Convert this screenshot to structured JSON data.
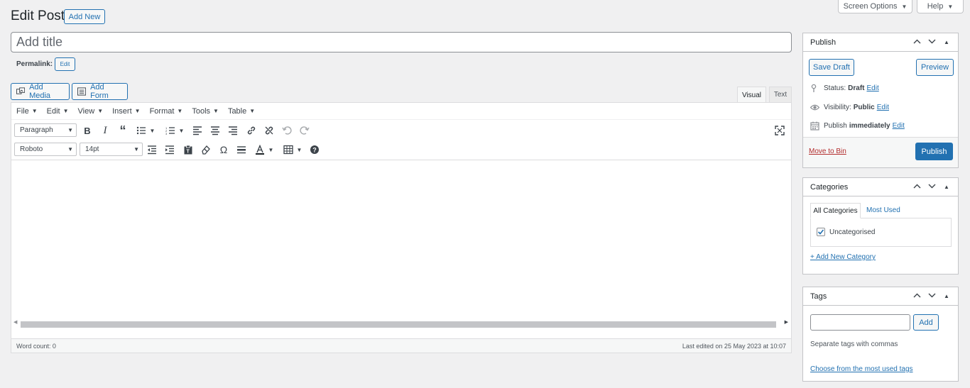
{
  "top": {
    "screen_options": "Screen Options",
    "help": "Help"
  },
  "header": {
    "title": "Edit Post",
    "add_new": "Add New"
  },
  "title_input": {
    "placeholder": "Add title",
    "value": ""
  },
  "permalink": {
    "label": "Permalink:",
    "edit": "Edit"
  },
  "media_buttons": {
    "add_media": "Add Media",
    "add_form": "Add Form"
  },
  "editor_tabs": {
    "visual": "Visual",
    "text": "Text"
  },
  "menubar": [
    "File",
    "Edit",
    "View",
    "Insert",
    "Format",
    "Tools",
    "Table"
  ],
  "toolbar": {
    "block_format": "Paragraph",
    "font_family": "Roboto",
    "font_size": "14pt"
  },
  "icons": {
    "row1": [
      "bold-icon",
      "italic-icon",
      "blockquote-icon",
      "bullet-list-icon",
      "numbered-list-icon",
      "align-left-icon",
      "align-center-icon",
      "align-right-icon",
      "link-icon",
      "unlink-icon",
      "undo-icon",
      "redo-icon",
      "fullscreen-icon"
    ],
    "row2": [
      "outdent-icon",
      "indent-icon",
      "paste-text-icon",
      "clear-formatting-icon",
      "special-character-icon",
      "horizontal-line-icon",
      "text-color-icon",
      "table-icon",
      "help-icon"
    ]
  },
  "status": {
    "word_count": "Word count: 0",
    "last_edited": "Last edited on 25 May 2023 at 10:07"
  },
  "publish": {
    "title": "Publish",
    "save_draft": "Save Draft",
    "preview": "Preview",
    "status_label": "Status:",
    "status_value": "Draft",
    "visibility_label": "Visibility:",
    "visibility_value": "Public",
    "publish_label": "Publish",
    "publish_value": "immediately",
    "edit": "Edit",
    "move_to_bin": "Move to Bin",
    "publish_button": "Publish"
  },
  "categories": {
    "title": "Categories",
    "tab_all": "All Categories",
    "tab_most_used": "Most Used",
    "items": [
      {
        "label": "Uncategorised",
        "checked": true
      }
    ],
    "add_new": "+ Add New Category"
  },
  "tags": {
    "title": "Tags",
    "add": "Add",
    "hint": "Separate tags with commas",
    "choose": "Choose from the most used tags"
  },
  "colors": {
    "accent": "#2271b1",
    "publish_bg": "#2271b1",
    "danger": "#b32d2e"
  }
}
